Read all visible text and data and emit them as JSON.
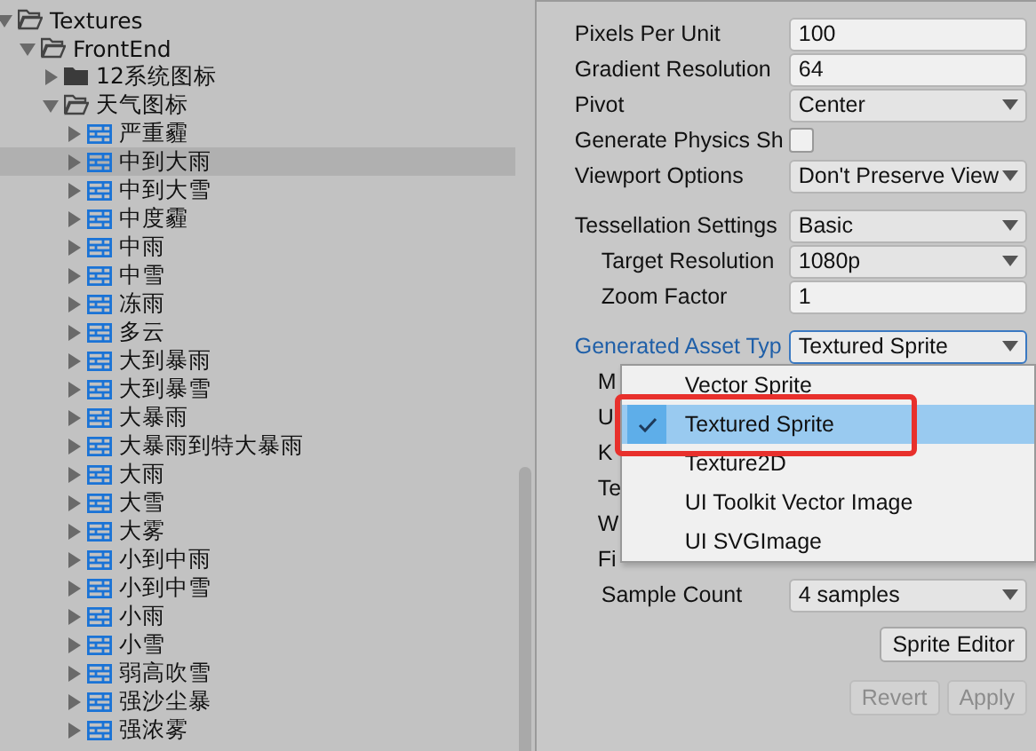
{
  "tree": [
    {
      "label": "Textures",
      "kind": "folder",
      "expanded": true,
      "selected": false,
      "children": [
        {
          "label": "FrontEnd",
          "kind": "folder",
          "expanded": true,
          "selected": false,
          "children": [
            {
              "label": "12系统图标",
              "kind": "folder",
              "expanded": false,
              "selected": false
            },
            {
              "label": "天气图标",
              "kind": "folder",
              "expanded": true,
              "selected": false,
              "children": [
                {
                  "label": "严重霾",
                  "kind": "asset",
                  "expanded": false,
                  "selected": false
                },
                {
                  "label": "中到大雨",
                  "kind": "asset",
                  "expanded": false,
                  "selected": true
                },
                {
                  "label": "中到大雪",
                  "kind": "asset",
                  "expanded": false,
                  "selected": false
                },
                {
                  "label": "中度霾",
                  "kind": "asset",
                  "expanded": false,
                  "selected": false
                },
                {
                  "label": "中雨",
                  "kind": "asset",
                  "expanded": false,
                  "selected": false
                },
                {
                  "label": "中雪",
                  "kind": "asset",
                  "expanded": false,
                  "selected": false
                },
                {
                  "label": "冻雨",
                  "kind": "asset",
                  "expanded": false,
                  "selected": false
                },
                {
                  "label": "多云",
                  "kind": "asset",
                  "expanded": false,
                  "selected": false
                },
                {
                  "label": "大到暴雨",
                  "kind": "asset",
                  "expanded": false,
                  "selected": false
                },
                {
                  "label": "大到暴雪",
                  "kind": "asset",
                  "expanded": false,
                  "selected": false
                },
                {
                  "label": "大暴雨",
                  "kind": "asset",
                  "expanded": false,
                  "selected": false
                },
                {
                  "label": "大暴雨到特大暴雨",
                  "kind": "asset",
                  "expanded": false,
                  "selected": false
                },
                {
                  "label": "大雨",
                  "kind": "asset",
                  "expanded": false,
                  "selected": false
                },
                {
                  "label": "大雪",
                  "kind": "asset",
                  "expanded": false,
                  "selected": false
                },
                {
                  "label": "大雾",
                  "kind": "asset",
                  "expanded": false,
                  "selected": false
                },
                {
                  "label": "小到中雨",
                  "kind": "asset",
                  "expanded": false,
                  "selected": false
                },
                {
                  "label": "小到中雪",
                  "kind": "asset",
                  "expanded": false,
                  "selected": false
                },
                {
                  "label": "小雨",
                  "kind": "asset",
                  "expanded": false,
                  "selected": false
                },
                {
                  "label": "小雪",
                  "kind": "asset",
                  "expanded": false,
                  "selected": false
                },
                {
                  "label": "弱高吹雪",
                  "kind": "asset",
                  "expanded": false,
                  "selected": false
                },
                {
                  "label": "强沙尘暴",
                  "kind": "asset",
                  "expanded": false,
                  "selected": false
                },
                {
                  "label": "强浓雾",
                  "kind": "asset",
                  "expanded": false,
                  "selected": false
                }
              ]
            }
          ]
        }
      ]
    }
  ],
  "inspector": {
    "groups": [
      [
        {
          "kind": "field",
          "label": "Pixels Per Unit",
          "value": "100"
        },
        {
          "kind": "field",
          "label": "Gradient Resolution",
          "value": "64"
        },
        {
          "kind": "dropdown",
          "label": "Pivot",
          "value": "Center",
          "open": false
        },
        {
          "kind": "checkbox",
          "label": "Generate Physics Sh",
          "checked": false
        },
        {
          "kind": "dropdown",
          "label": "Viewport Options",
          "value": "Don't Preserve View",
          "open": false
        }
      ],
      [
        {
          "kind": "dropdown",
          "label": "Tessellation Settings",
          "value": "Basic",
          "open": false,
          "children": [
            {
              "kind": "dropdown",
              "label": "Target Resolution",
              "value": "1080p",
              "open": false
            },
            {
              "kind": "field",
              "label": "Zoom Factor",
              "value": "1"
            }
          ]
        }
      ],
      [
        {
          "kind": "dropdown",
          "label": "Generated Asset Typ",
          "value": "Textured Sprite",
          "open": true,
          "children": [
            {
              "kind": "label",
              "label": "M"
            },
            {
              "kind": "label",
              "label": "U"
            },
            {
              "kind": "label",
              "label": "K"
            },
            {
              "kind": "label",
              "label": "Te"
            },
            {
              "kind": "label",
              "label": "W"
            },
            {
              "kind": "label",
              "label": "Fi"
            },
            {
              "kind": "dropdown",
              "label": "Sample Count",
              "value": "4 samples",
              "open": false
            }
          ]
        }
      ]
    ]
  },
  "popup": {
    "options": [
      {
        "label": "Vector Sprite",
        "selected": false
      },
      {
        "label": "Textured Sprite",
        "selected": true
      },
      {
        "label": "Texture2D",
        "selected": false
      },
      {
        "label": "UI Toolkit Vector Image",
        "selected": false
      },
      {
        "label": "UI SVGImage",
        "selected": false
      }
    ]
  },
  "buttons": [
    {
      "label": "Sprite Editor",
      "disabled": false
    }
  ],
  "footer_buttons": [
    {
      "label": "Revert",
      "disabled": true
    },
    {
      "label": "Apply",
      "disabled": true
    }
  ]
}
